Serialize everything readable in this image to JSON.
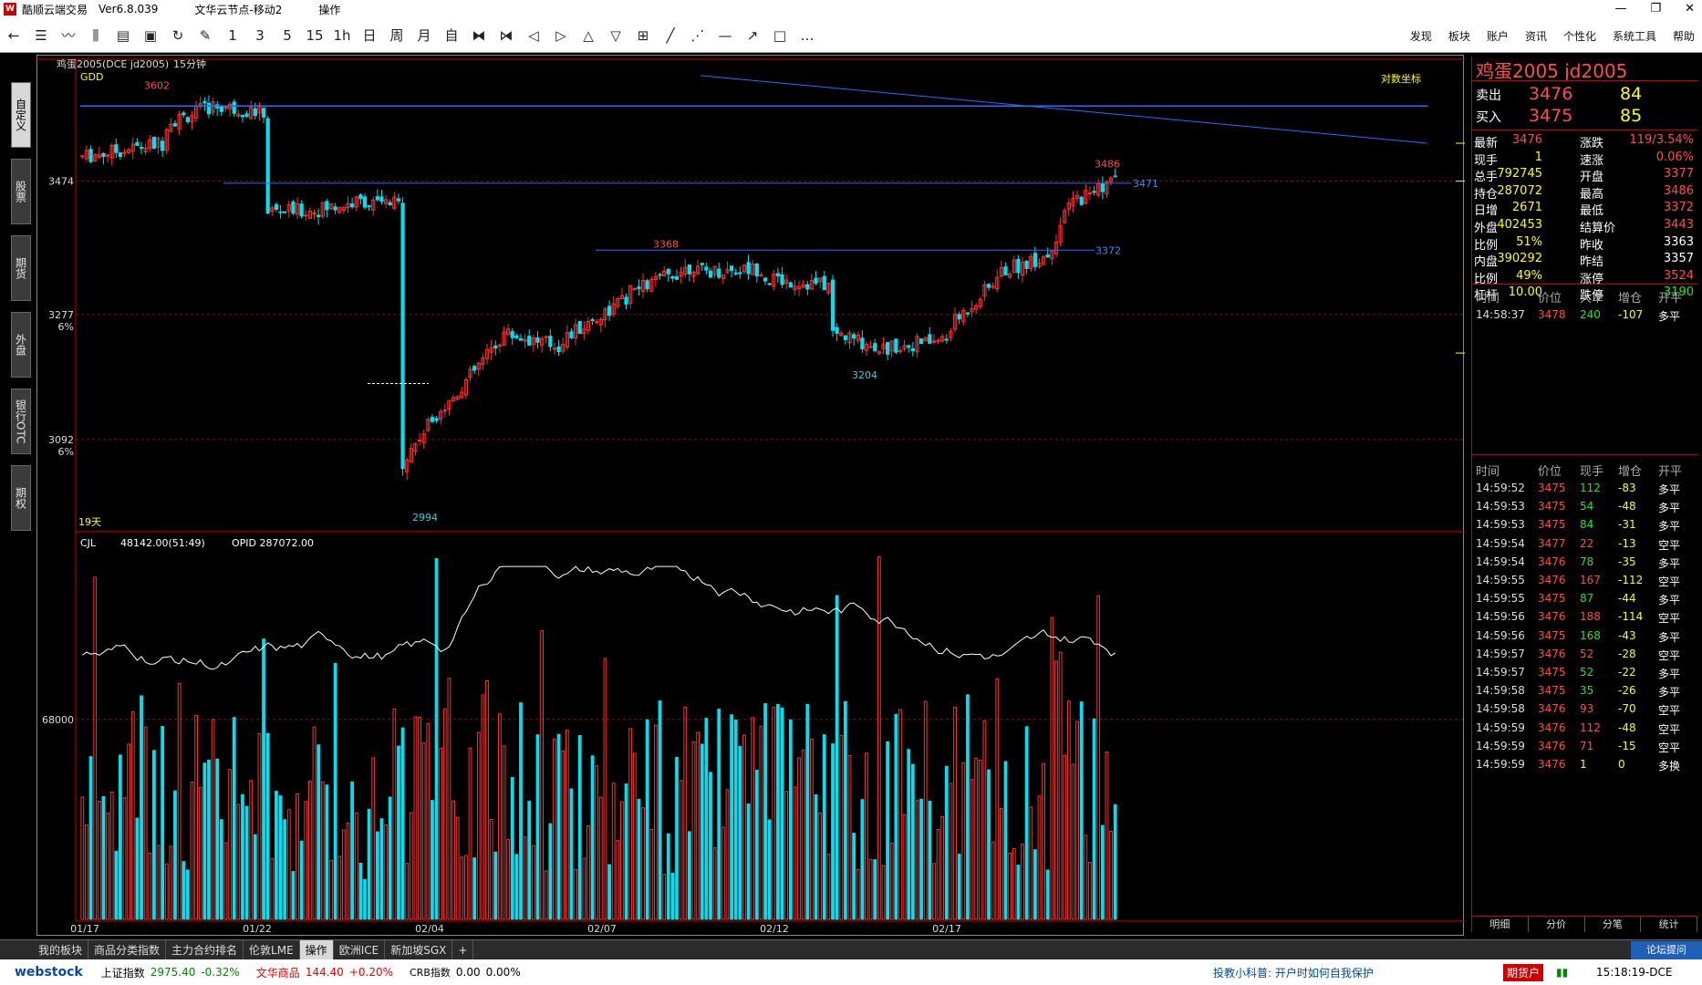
{
  "titlebar": {
    "app": "酷顺云端交易",
    "version": "Ver6.8.039",
    "server": "文华云节点-移动2",
    "mode": "操作"
  },
  "toolbar": {
    "periods": [
      "1",
      "3",
      "5",
      "15",
      "1h",
      "日",
      "周",
      "月",
      "自"
    ],
    "menu": [
      "发现",
      "板块",
      "账户",
      "资讯",
      "个性化",
      "系统工具",
      "帮助"
    ]
  },
  "sidebar": [
    "自定义",
    "股票",
    "期货",
    "外盘",
    "银行OTC",
    "期权"
  ],
  "chart_header": {
    "symbol": "鸡蛋2005(DCE jd2005)",
    "period": "15分钟",
    "indicator": "GDD",
    "log_label": "对数坐标",
    "days_label": "19天",
    "volume_indicator": "CJL",
    "volume_value": "48142.00(51:49)",
    "opid": "OPID 287072.00"
  },
  "chart_data": {
    "type": "candlestick",
    "price_axis": {
      "ticks": [
        "3474",
        "3277",
        "3092"
      ],
      "pct_ticks": [
        "6%",
        "6%"
      ],
      "range": [
        2960,
        3650
      ]
    },
    "volume_axis": {
      "ticks": [
        "68000"
      ],
      "range": [
        0,
        125000
      ]
    },
    "dates": [
      "01/17",
      "01/22",
      "02/04",
      "02/07",
      "02/12",
      "02/17"
    ],
    "annotations": [
      {
        "label": "3602",
        "value": 3602
      },
      {
        "label": "3368",
        "value": 3368
      },
      {
        "label": "3204",
        "value": 3204
      },
      {
        "label": "2994",
        "value": 2994
      },
      {
        "label": "3486",
        "value": 3486
      },
      {
        "label": "3471",
        "value": 3471
      },
      {
        "label": "3372",
        "value": 3372
      }
    ],
    "segments": [
      {
        "n": 20,
        "start": 3510,
        "end": 3530,
        "vol": 1
      },
      {
        "n": 12,
        "start": 3560,
        "end": 3585,
        "vol": 1
      },
      {
        "n": 12,
        "start": 3585,
        "end": 3575,
        "vol": 1
      },
      {
        "n": 10,
        "start": 3430,
        "end": 3430,
        "vol": 0.9
      },
      {
        "n": 14,
        "start": 3430,
        "end": 3445,
        "vol": 0.9
      },
      {
        "n": 8,
        "start": 3440,
        "end": 3440,
        "vol": 0.9
      },
      {
        "n": 10,
        "start": 3060,
        "end": 3140,
        "vol": 1.2
      },
      {
        "n": 14,
        "start": 3140,
        "end": 3240,
        "vol": 1.1
      },
      {
        "n": 14,
        "start": 3250,
        "end": 3230,
        "vol": 1
      },
      {
        "n": 16,
        "start": 3240,
        "end": 3300,
        "vol": 1
      },
      {
        "n": 16,
        "start": 3310,
        "end": 3350,
        "vol": 1
      },
      {
        "n": 16,
        "start": 3340,
        "end": 3345,
        "vol": 1
      },
      {
        "n": 16,
        "start": 3330,
        "end": 3320,
        "vol": 1
      },
      {
        "n": 14,
        "start": 3250,
        "end": 3225,
        "vol": 1.1
      },
      {
        "n": 14,
        "start": 3230,
        "end": 3240,
        "vol": 1
      },
      {
        "n": 12,
        "start": 3260,
        "end": 3330,
        "vol": 1.1
      },
      {
        "n": 12,
        "start": 3340,
        "end": 3365,
        "vol": 1
      },
      {
        "n": 4,
        "start": 3380,
        "end": 3420,
        "vol": 1.4
      },
      {
        "n": 12,
        "start": 3440,
        "end": 3478,
        "vol": 1.1
      }
    ],
    "up_color": "#ff3030",
    "down_color": "#00e0f0",
    "grid": "dashed-red"
  },
  "quote": {
    "name": "鸡蛋2005  jd2005",
    "sell_label": "卖出",
    "sell_price": "3476",
    "sell_vol": "84",
    "buy_label": "买入",
    "buy_price": "3475",
    "buy_vol": "85",
    "stats": [
      {
        "l": "最新",
        "v": "3476",
        "vc": "rq",
        "l2": "涨跌",
        "v2": "119/3.54%",
        "v2c": "rq"
      },
      {
        "l": "现手",
        "v": "1",
        "vc": "yl",
        "l2": "速涨",
        "v2": "0.06%",
        "v2c": "rq"
      },
      {
        "l": "总手",
        "v": "792745",
        "vc": "yl",
        "l2": "开盘",
        "v2": "3377",
        "v2c": "rq"
      },
      {
        "l": "持仓",
        "v": "287072",
        "vc": "yl",
        "l2": "最高",
        "v2": "3486",
        "v2c": "rq"
      },
      {
        "l": "日增",
        "v": "2671",
        "vc": "yl",
        "l2": "最低",
        "v2": "3372",
        "v2c": "rq"
      },
      {
        "l": "外盘",
        "v": "402453",
        "vc": "yl",
        "l2": "结算价",
        "v2": "3443",
        "v2c": "rq"
      },
      {
        "l": "比例",
        "v": "51%",
        "vc": "yl",
        "l2": "昨收",
        "v2": "3363",
        "v2c": "wh"
      },
      {
        "l": "内盘",
        "v": "390292",
        "vc": "yl",
        "l2": "昨结",
        "v2": "3357",
        "v2c": "wh"
      },
      {
        "l": "比例",
        "v": "49%",
        "vc": "yl",
        "l2": "涨停",
        "v2": "3524",
        "v2c": "rq"
      },
      {
        "l": "杠杆",
        "v": "10.00",
        "vc": "yl",
        "l2": "跌停",
        "v2": "3190",
        "v2c": "gq"
      }
    ],
    "big_header": [
      "时间",
      "价位",
      "大单",
      "增仓",
      "开平"
    ],
    "big_rows": [
      [
        "14:58:37",
        "3478",
        "240",
        "-107",
        "多平"
      ]
    ],
    "tick_header": [
      "时间",
      "价位",
      "现手",
      "增仓",
      "开平"
    ],
    "ticks": [
      [
        "14:59:52",
        "3475",
        "112",
        "-83",
        "多平"
      ],
      [
        "14:59:53",
        "3475",
        "54",
        "-48",
        "多平"
      ],
      [
        "14:59:53",
        "3475",
        "84",
        "-31",
        "多平"
      ],
      [
        "14:59:54",
        "3477",
        "22",
        "-13",
        "空平"
      ],
      [
        "14:59:54",
        "3476",
        "78",
        "-35",
        "多平"
      ],
      [
        "14:59:55",
        "3476",
        "167",
        "-112",
        "空平"
      ],
      [
        "14:59:55",
        "3475",
        "87",
        "-44",
        "多平"
      ],
      [
        "14:59:56",
        "3476",
        "188",
        "-114",
        "空平"
      ],
      [
        "14:59:56",
        "3475",
        "168",
        "-43",
        "多平"
      ],
      [
        "14:59:57",
        "3476",
        "52",
        "-28",
        "空平"
      ],
      [
        "14:59:57",
        "3475",
        "52",
        "-22",
        "多平"
      ],
      [
        "14:59:58",
        "3475",
        "35",
        "-26",
        "多平"
      ],
      [
        "14:59:58",
        "3476",
        "93",
        "-70",
        "空平"
      ],
      [
        "14:59:59",
        "3476",
        "112",
        "-48",
        "空平"
      ],
      [
        "14:59:59",
        "3476",
        "71",
        "-15",
        "空平"
      ],
      [
        "14:59:59",
        "3476",
        "1",
        "0",
        "多换"
      ]
    ],
    "tabs": [
      "明细",
      "分价",
      "分笔",
      "统计"
    ]
  },
  "bottom_tabs": [
    "我的板块",
    "商品分类指数",
    "主力合约排名",
    "伦敦LME",
    "操作",
    "欧洲ICE",
    "新加坡SGX",
    "+"
  ],
  "status": {
    "brand": "webstock",
    "idx1_name": "上证指数",
    "idx1_val": "2975.40",
    "idx1_chg": "-0.32%",
    "idx2_name": "文华商品",
    "idx2_val": "144.40",
    "idx2_chg": "+0.20%",
    "idx3_name": "CRB指数",
    "idx3_val": "0.00",
    "idx3_chg": "0.00%",
    "tip": "投教小科普: 开户时如何自我保护",
    "account": "期货户",
    "time": "15:18:19-DCE",
    "forum": "论坛提问"
  }
}
